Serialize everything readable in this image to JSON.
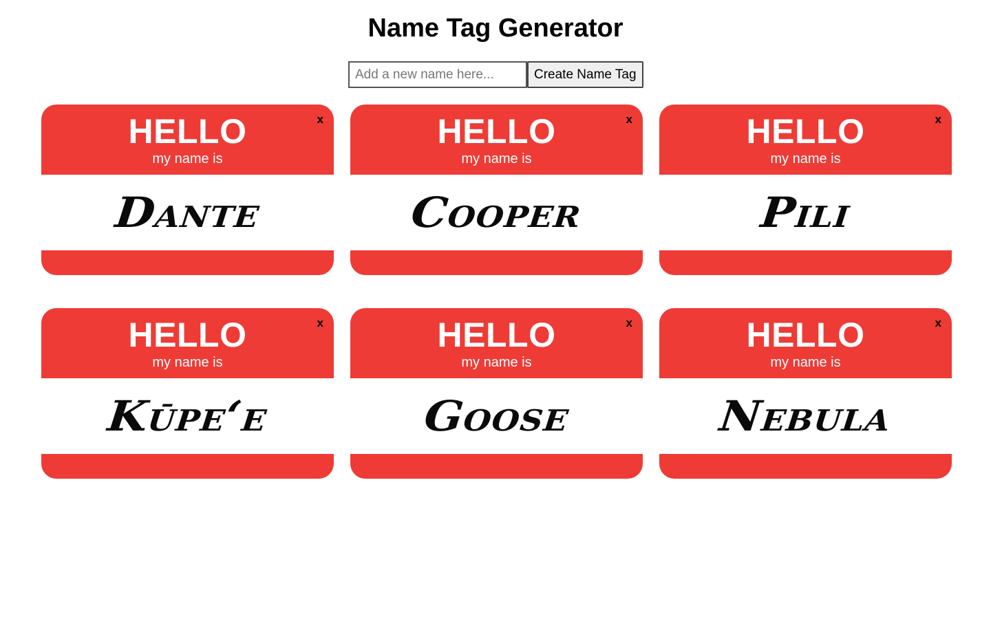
{
  "header": {
    "title": "Name Tag Generator"
  },
  "form": {
    "input_value": "",
    "input_placeholder": "Add a new name here...",
    "button_label": "Create Name Tag"
  },
  "tag_template": {
    "hello": "HELLO",
    "subtitle": "my name is",
    "remove_label": "x"
  },
  "tags": [
    {
      "name": "Dante"
    },
    {
      "name": "Cooper"
    },
    {
      "name": "Pili"
    },
    {
      "name": "Kūpe‘e"
    },
    {
      "name": "Goose"
    },
    {
      "name": "Nebula"
    }
  ],
  "colors": {
    "tag_red": "#ee3b36",
    "tag_body": "#ffffff",
    "name_ink": "#0a0a0a"
  },
  "icons": {
    "remove": "close-icon"
  }
}
